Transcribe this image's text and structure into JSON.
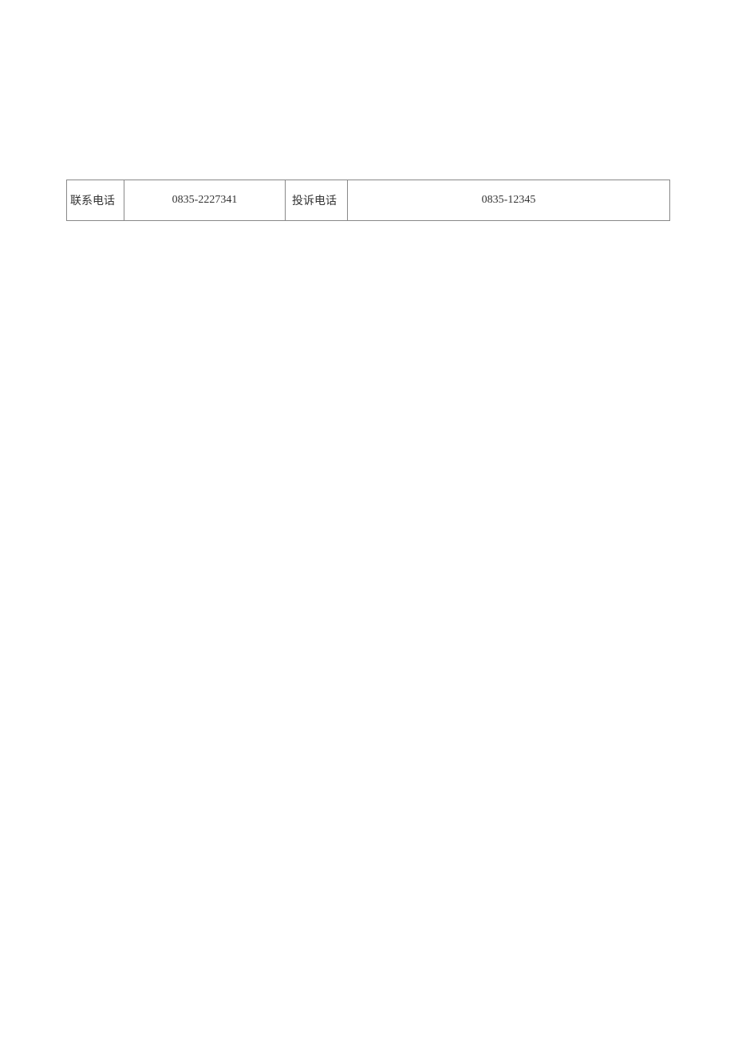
{
  "contact_row": {
    "contact_phone_label": "联系电话",
    "contact_phone_value": "0835-2227341",
    "complaint_phone_label": "投诉电话",
    "complaint_phone_value": "0835-12345"
  }
}
